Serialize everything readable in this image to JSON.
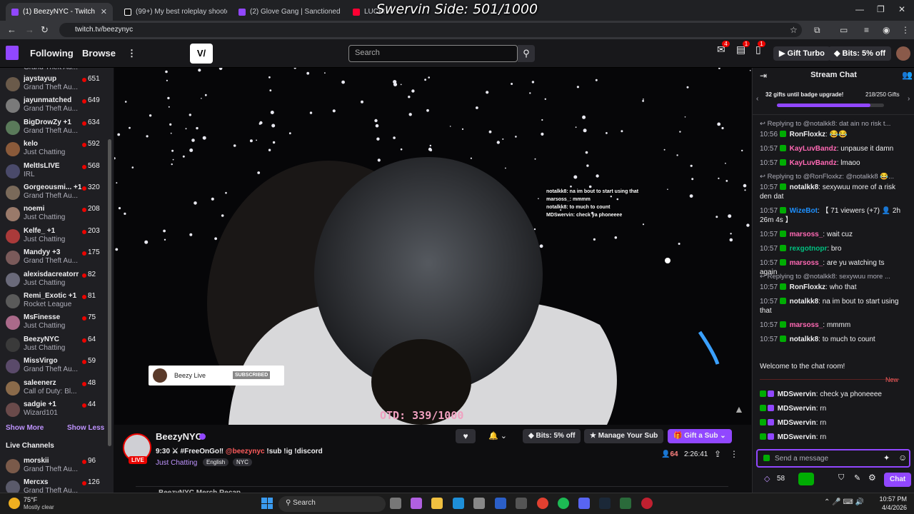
{
  "browser": {
    "tabs": [
      {
        "label": "(1) BeezyNYC - Twitch",
        "active": true
      },
      {
        "label": "(99+) My best roleplay shooter",
        "active": false
      },
      {
        "label": "(2) Glove Gang | Sanctioned",
        "active": false
      },
      {
        "label": "LUCKI",
        "active": false
      }
    ],
    "url": "twitch.tv/beezynyc",
    "overlay_title": "Swervin Side: 501/1000"
  },
  "topnav": {
    "following": "Following",
    "browse": "Browse",
    "search_placeholder": "Search",
    "gift_turbo": "Gift Turbo",
    "bits": "Bits: 5% off",
    "notif_counts": [
      "4",
      "1",
      "1"
    ]
  },
  "sidebar": {
    "channels": [
      {
        "name": "jaystayup",
        "game": "Grand Theft Au...",
        "viewers": "651",
        "color": "#6a5a4a"
      },
      {
        "name": "jayunmatched",
        "game": "Grand Theft Au...",
        "viewers": "649",
        "color": "#7a7a7a"
      },
      {
        "name": "BigDrowZy +1",
        "game": "Grand Theft Au...",
        "viewers": "634",
        "color": "#5a7a5a"
      },
      {
        "name": "kelo",
        "game": "Just Chatting",
        "viewers": "592",
        "color": "#8a5a3a"
      },
      {
        "name": "MeltIsLIVE",
        "game": "IRL",
        "viewers": "568",
        "color": "#4a4a6a"
      },
      {
        "name": "Gorgeousmi... +1",
        "game": "Grand Theft Au...",
        "viewers": "320",
        "color": "#7a6a5a"
      },
      {
        "name": "noemi",
        "game": "Just Chatting",
        "viewers": "208",
        "color": "#9a7a6a"
      },
      {
        "name": "Kelfe_ +1",
        "game": "Just Chatting",
        "viewers": "203",
        "color": "#aa3a3a"
      },
      {
        "name": "Mandyy +3",
        "game": "Grand Theft Au...",
        "viewers": "175",
        "color": "#7a5a5a"
      },
      {
        "name": "alexisdacreatorr",
        "game": "Just Chatting",
        "viewers": "82",
        "color": "#6a6a7a"
      },
      {
        "name": "Remi_Exotic +1",
        "game": "Rocket League",
        "viewers": "81",
        "color": "#5a5a5a"
      },
      {
        "name": "MsFinesse",
        "game": "Just Chatting",
        "viewers": "75",
        "color": "#aa6a8a"
      },
      {
        "name": "BeezyNYC",
        "game": "Just Chatting",
        "viewers": "64",
        "color": "#3a3a3a"
      },
      {
        "name": "MissVirgo",
        "game": "Grand Theft Au...",
        "viewers": "59",
        "color": "#5a4a6a"
      },
      {
        "name": "saleenerz",
        "game": "Call of Duty: Bl...",
        "viewers": "48",
        "color": "#8a6a4a"
      },
      {
        "name": "sadgie +1",
        "game": "Wizard101",
        "viewers": "44",
        "color": "#6a4a4a"
      }
    ],
    "show_more": "Show More",
    "show_less": "Show Less",
    "live_channels_heading": "Live Channels",
    "live_channels": [
      {
        "name": "morskii",
        "game": "Grand Theft Au...",
        "viewers": "96",
        "color": "#7a5a4a"
      },
      {
        "name": "Mercxs",
        "game": "Grand Theft Au...",
        "viewers": "126",
        "color": "#5a5a6a"
      }
    ]
  },
  "video": {
    "overlay_chat": [
      "notalkk8: na im bout to start using that",
      "marsoss_: mmmm",
      "notalkk8: to much to count",
      "MDSwervin: check ya phoneeee"
    ],
    "sub_name": "Beezy Live",
    "sub_status": "SUBSCRIBED",
    "otd": "OTD: 339/1000"
  },
  "stream": {
    "channel": "BeezyNYC",
    "live_badge": "LIVE",
    "title_prefix": "9:30 ⚔ #FreeOnGo‼",
    "title_mention": "@beezynyc",
    "title_suffix": "!sub !ig !discord",
    "category": "Just Chatting",
    "tags": [
      "English",
      "NYC"
    ],
    "bits": "Bits: 5% off",
    "manage_sub": "Manage Your Sub",
    "gift_sub": "Gift a Sub",
    "viewers": "64",
    "uptime": "2:26:41",
    "merch_banner": "BeezyNYC Merch Recap"
  },
  "chat": {
    "heading": "Stream Chat",
    "gift_goal": "32 gifts until badge upgrade!",
    "gift_count": "218/250 Gifts",
    "gift_progress": 0.872,
    "new_label": "New",
    "welcome": "Welcome to the chat room!",
    "input_placeholder": "Send a message",
    "points": "58",
    "chat_button": "Chat",
    "messages": [
      {
        "reply": "Replying to @notalkk8: dat ain no risk t..."
      },
      {
        "time": "10:56",
        "user": "RonFloxkz",
        "color": "#efeff1",
        "text": ": 😂😂"
      },
      {
        "time": "10:57",
        "user": "KayLuvBandz",
        "color": "#ff69b4",
        "text": ": unpause it damn"
      },
      {
        "time": "10:57",
        "user": "KayLuvBandz",
        "color": "#ff69b4",
        "text": ": lmaoo"
      },
      {
        "reply": "Replying to @RonFloxkz: @notalkk8 😂..."
      },
      {
        "time": "10:57",
        "user": "notalkk8",
        "color": "#efeff1",
        "text": ": sexywuu more of a risk den dat"
      },
      {
        "time": "10:57",
        "user": "WizeBot",
        "color": "#1e90ff",
        "text": ": 【 71 viewers (+7) 👤 2h 26m 4s 】"
      },
      {
        "time": "10:57",
        "user": "marsoss_",
        "color": "#ff69b4",
        "text": ": wait cuz"
      },
      {
        "time": "10:57",
        "user": "rexgotnopr",
        "color": "#00c080",
        "text": ": bro"
      },
      {
        "time": "10:57",
        "user": "marsoss_",
        "color": "#ff69b4",
        "text": ": are yu watching ts again"
      },
      {
        "reply": "Replying to @notalkk8: sexywuu more ..."
      },
      {
        "time": "10:57",
        "user": "RonFloxkz",
        "color": "#efeff1",
        "text": ": who that"
      },
      {
        "time": "10:57",
        "user": "notalkk8",
        "color": "#efeff1",
        "text": ": na im bout to start using that"
      },
      {
        "time": "10:57",
        "user": "marsoss_",
        "color": "#ff69b4",
        "text": ": mmmm"
      },
      {
        "time": "10:57",
        "user": "notalkk8",
        "color": "#efeff1",
        "text": ": to much to count"
      }
    ],
    "new_messages": [
      {
        "user": "MDSwervin",
        "text": ": check ya phoneeee"
      },
      {
        "user": "MDSwervin",
        "text": ": rn"
      },
      {
        "user": "MDSwervin",
        "text": ": rn"
      },
      {
        "user": "MDSwervin",
        "text": ": rn"
      }
    ]
  },
  "taskbar": {
    "temp": "75°F",
    "weather": "Mostly clear",
    "search": "Search",
    "time": "10:57 PM",
    "date": "4/4/2026"
  },
  "colors": {
    "twitch_purple": "#9147ff",
    "live_red": "#eb0400"
  }
}
